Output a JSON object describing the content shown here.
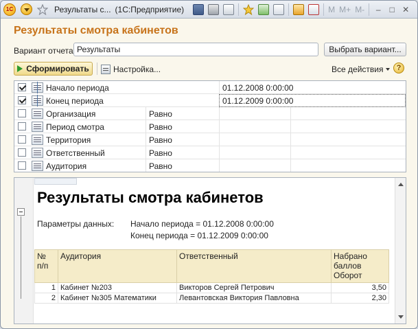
{
  "titlebar": {
    "logo_text": "1С",
    "doc_title": "Результаты с...",
    "app_title": "(1С:Предприятие)",
    "m_buttons": [
      "M",
      "M+",
      "M-"
    ],
    "minimize": "–",
    "maximize": "□",
    "close": "✕"
  },
  "report_form": {
    "title": "Результаты смотра кабинетов",
    "variant_label": "Вариант отчета:",
    "variant_value": "Результаты",
    "choose_variant_label": "Выбрать вариант...",
    "generate_label": "Сформировать",
    "settings_label": "Настройка...",
    "all_actions_label": "Все действия",
    "help_label": "?"
  },
  "settings_grid": {
    "rows": [
      {
        "checked": true,
        "name": "Начало периода",
        "comparison": "",
        "value": "01.12.2008 0:00:00",
        "period": true
      },
      {
        "checked": true,
        "name": "Конец периода",
        "comparison": "",
        "value": "01.12.2009 0:00:00",
        "period": true
      },
      {
        "checked": false,
        "name": "Организация",
        "comparison": "Равно",
        "value": "",
        "period": false
      },
      {
        "checked": false,
        "name": "Период смотра",
        "comparison": "Равно",
        "value": "",
        "period": false
      },
      {
        "checked": false,
        "name": "Территория",
        "comparison": "Равно",
        "value": "",
        "period": false
      },
      {
        "checked": false,
        "name": "Ответственный",
        "comparison": "Равно",
        "value": "",
        "period": false
      },
      {
        "checked": false,
        "name": "Аудитория",
        "comparison": "Равно",
        "value": "",
        "period": false
      }
    ]
  },
  "report": {
    "title": "Результаты смотра кабинетов",
    "params_label": "Параметры данных:",
    "param_start": "Начало периода = 01.12.2008 0:00:00",
    "param_end": "Конец периода = 01.12.2009 0:00:00",
    "table": {
      "headers": [
        "№\nп/п",
        "Аудитория",
        "Ответственный",
        "Набрано\nбаллов\nОборот"
      ],
      "rows": [
        [
          "1",
          "Кабинет №203",
          "Викторов Сергей Петрович",
          "3,50"
        ],
        [
          "2",
          "Кабинет №305 Математики",
          "Левантовская Виктория Павловна",
          "2,30"
        ]
      ]
    }
  }
}
